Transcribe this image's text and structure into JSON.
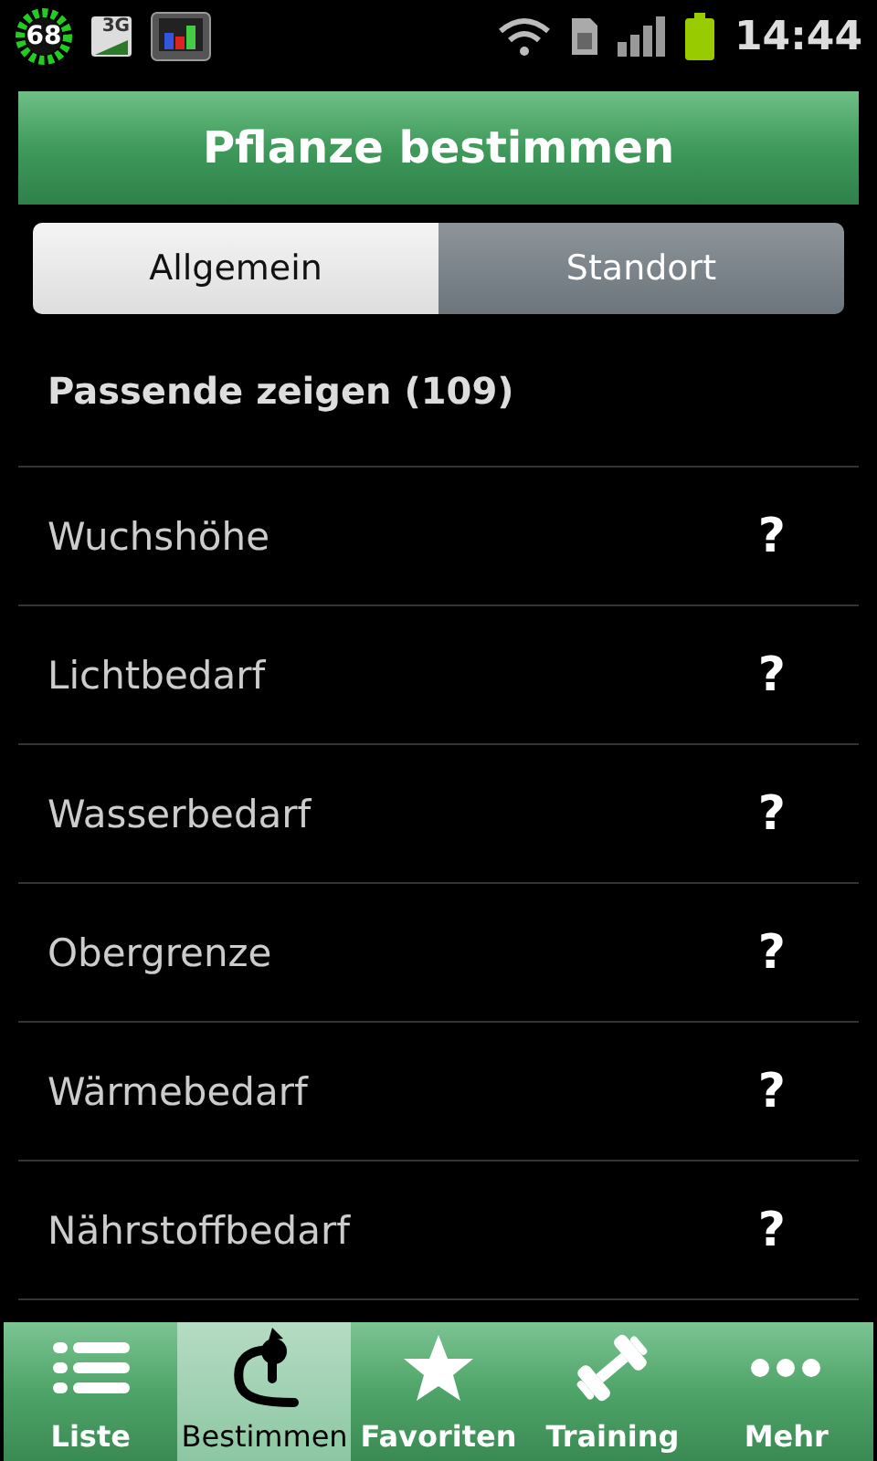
{
  "status_bar": {
    "battery_widget": "68",
    "network_badge": "3G",
    "time": "14:44"
  },
  "title": "Pflanze bestimmen",
  "tabs": [
    {
      "label": "Allgemein",
      "selected": false
    },
    {
      "label": "Standort",
      "selected": true
    }
  ],
  "summary": "Passende zeigen (109)",
  "criteria": [
    {
      "label": "Wuchshöhe",
      "value": "?"
    },
    {
      "label": "Lichtbedarf",
      "value": "?"
    },
    {
      "label": "Wasserbedarf",
      "value": "?"
    },
    {
      "label": "Obergrenze",
      "value": "?"
    },
    {
      "label": "Wärmebedarf",
      "value": "?"
    },
    {
      "label": "Nährstoffbedarf",
      "value": "?"
    }
  ],
  "nav": [
    {
      "label": "Liste",
      "kind": "list",
      "selected": false
    },
    {
      "label": "Bestimmen",
      "kind": "identify",
      "selected": true
    },
    {
      "label": "Favoriten",
      "kind": "star",
      "selected": false
    },
    {
      "label": "Training",
      "kind": "dumbbell",
      "selected": false
    },
    {
      "label": "Mehr",
      "kind": "more",
      "selected": false
    }
  ]
}
